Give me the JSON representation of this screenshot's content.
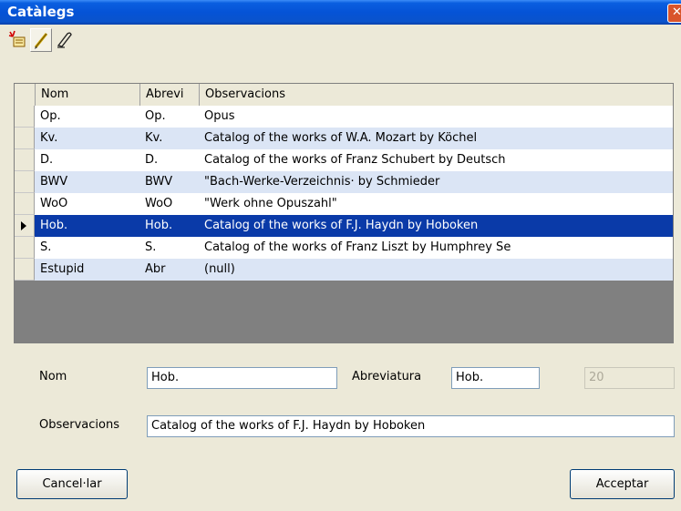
{
  "window": {
    "title": "Catàlegs",
    "close_glyph": "✕"
  },
  "toolbar": {
    "icons": [
      "new-record-icon",
      "edit-pencil-icon",
      "eraser-icon"
    ]
  },
  "grid": {
    "columns": [
      "Nom",
      "Abrevi",
      "Observacions"
    ],
    "rows": [
      {
        "nom": "Op.",
        "abrevi": "Op.",
        "obs": "Opus"
      },
      {
        "nom": "Kv.",
        "abrevi": "Kv.",
        "obs": "Catalog of the works of W.A. Mozart by Köchel"
      },
      {
        "nom": "D.",
        "abrevi": "D.",
        "obs": "Catalog of the works of Franz Schubert by Deutsch"
      },
      {
        "nom": "BWV",
        "abrevi": "BWV",
        "obs": "\"Bach-Werke-Verzeichnis· by Schmieder"
      },
      {
        "nom": "WoO",
        "abrevi": "WoO",
        "obs": "\"Werk ohne Opuszahl\""
      },
      {
        "nom": "Hob.",
        "abrevi": "Hob.",
        "obs": "Catalog of the works of F.J. Haydn by Hoboken"
      },
      {
        "nom": "S.",
        "abrevi": "S.",
        "obs": "Catalog of the works of Franz Liszt by Humphrey Se"
      },
      {
        "nom": "Estupid",
        "abrevi": "Abr",
        "obs": "(null)"
      }
    ],
    "selected_index": 5
  },
  "form": {
    "nom_label": "Nom",
    "nom_value": "Hob.",
    "abrev_label": "Abreviatura",
    "abrev_value": "Hob.",
    "number_value": "20",
    "obs_label": "Observacions",
    "obs_value": "Catalog of the works of F.J. Haydn by Hoboken"
  },
  "buttons": {
    "cancel": "Cancel·lar",
    "accept": "Acceptar"
  }
}
